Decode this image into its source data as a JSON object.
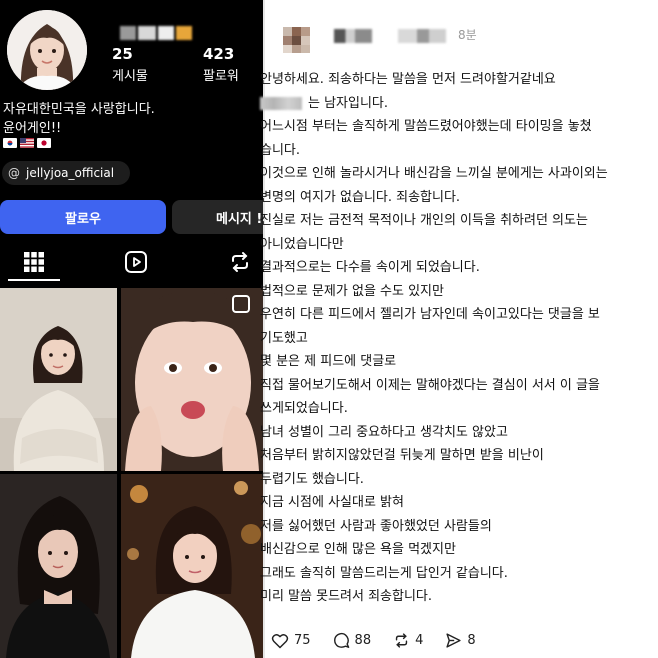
{
  "profile": {
    "stats": [
      {
        "value": "25",
        "label": "게시물"
      },
      {
        "value": "423",
        "label": "팔로워"
      }
    ],
    "bio_line1": "자유대한민국을 사랑합니다.",
    "bio_line2": "윤어게인!!",
    "flags": [
      "flag-korea",
      "flag-usa",
      "flag-japan"
    ],
    "threads_handle": "jellyjoa_official",
    "follow_label": "팔로우",
    "message_label": "메시지 !",
    "tabs": [
      "grid-icon",
      "reels-icon",
      "reposts-icon"
    ]
  },
  "post": {
    "time": "8분",
    "name_suffix": "는 남자입니다.",
    "lines": [
      "안녕하세요. 죄송하다는 말씀을 먼저 드려야할거같네요",
      "어느시점 부터는 솔직하게 말씀드렸어야했는데 타이밍을 놓쳤",
      "습니다.",
      "이것으로 인해 놀라시거나 배신감을 느끼실 분에게는 사과이외는",
      "변명의 여지가 없습니다. 죄송합니다.",
      "진실로 저는 금전적 목적이나 개인의 이득을 취하려던 의도는",
      "아니었습니다만",
      "결과적으로는 다수를 속이게 되었습니다.",
      "법적으로 문제가 없을 수도 있지만",
      "우연히 다른 피드에서 젤리가 남자인데 속이고있다는 댓글을 보",
      "기도했고",
      "몇 분은 제 피드에 댓글로",
      "직접 물어보기도해서 이제는 말해야겠다는 결심이 서서 이 글을",
      "쓰게되었습니다.",
      "남녀 성별이 그리 중요하다고 생각치도 않았고",
      "처음부터 밝히지않았던걸 뒤늦게 말하면 받을 비난이",
      "두렵기도 했습니다.",
      "지금 시점에 사실대로 밝혀",
      "저를 싫어했던 사람과 좋아했었던 사람들의",
      "배신감으로 인해 많은 욕을 먹겠지만",
      "그래도 솔직히 말씀드리는게 답인거 같습니다.",
      "미리 말씀 못드려서 죄송합니다."
    ],
    "actions": [
      {
        "icon": "heart-icon",
        "count": "75"
      },
      {
        "icon": "comment-icon",
        "count": "88"
      },
      {
        "icon": "repost-icon",
        "count": "4"
      },
      {
        "icon": "share-icon",
        "count": "8"
      }
    ]
  }
}
